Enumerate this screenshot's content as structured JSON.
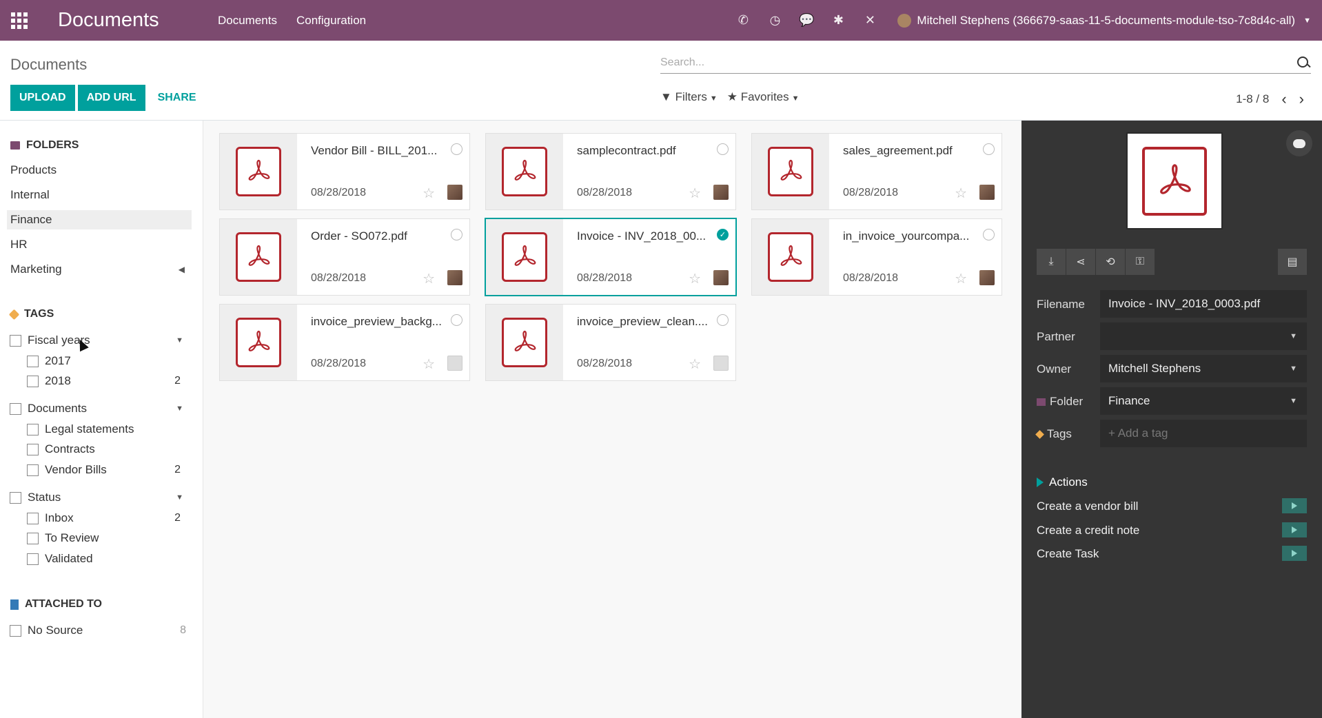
{
  "topbar": {
    "app_title": "Documents",
    "menu": [
      "Documents",
      "Configuration"
    ],
    "user_label": "Mitchell Stephens (366679-saas-11-5-documents-module-tso-7c8d4c-all)"
  },
  "control_panel": {
    "breadcrumb": "Documents",
    "buttons": {
      "upload": "UPLOAD",
      "add_url": "ADD URL",
      "share": "SHARE"
    },
    "search_placeholder": "Search...",
    "filters_label": "Filters",
    "favorites_label": "Favorites",
    "pager": "1-8 / 8"
  },
  "sidebar": {
    "folders_title": "FOLDERS",
    "folders": [
      "Products",
      "Internal",
      "Finance",
      "HR",
      "Marketing"
    ],
    "active_folder": "Finance",
    "tags_title": "TAGS",
    "tag_groups": [
      {
        "name": "Fiscal years",
        "items": [
          {
            "name": "2017",
            "count": ""
          },
          {
            "name": "2018",
            "count": "2"
          }
        ]
      },
      {
        "name": "Documents",
        "items": [
          {
            "name": "Legal statements",
            "count": ""
          },
          {
            "name": "Contracts",
            "count": ""
          },
          {
            "name": "Vendor Bills",
            "count": "2"
          }
        ]
      },
      {
        "name": "Status",
        "items": [
          {
            "name": "Inbox",
            "count": "2"
          },
          {
            "name": "To Review",
            "count": ""
          },
          {
            "name": "Validated",
            "count": ""
          }
        ]
      }
    ],
    "attached_title": "ATTACHED TO",
    "attached": [
      {
        "name": "No Source",
        "count": "8"
      }
    ]
  },
  "documents": [
    {
      "name": "Vendor Bill - BILL_201...",
      "date": "08/28/2018",
      "selected": false
    },
    {
      "name": "samplecontract.pdf",
      "date": "08/28/2018",
      "selected": false
    },
    {
      "name": "sales_agreement.pdf",
      "date": "08/28/2018",
      "selected": false
    },
    {
      "name": "Order - SO072.pdf",
      "date": "08/28/2018",
      "selected": false
    },
    {
      "name": "Invoice - INV_2018_00...",
      "date": "08/28/2018",
      "selected": true
    },
    {
      "name": "in_invoice_yourcompa...",
      "date": "08/28/2018",
      "selected": false
    },
    {
      "name": "invoice_preview_backg...",
      "date": "08/28/2018",
      "selected": false
    },
    {
      "name": "invoice_preview_clean....",
      "date": "08/28/2018",
      "selected": false
    }
  ],
  "panel": {
    "fields": {
      "filename_label": "Filename",
      "filename_value": "Invoice - INV_2018_0003.pdf",
      "partner_label": "Partner",
      "partner_value": "",
      "owner_label": "Owner",
      "owner_value": "Mitchell Stephens",
      "folder_label": "Folder",
      "folder_value": "Finance",
      "tags_label": "Tags",
      "tags_placeholder": "+ Add a tag"
    },
    "actions_title": "Actions",
    "actions": [
      "Create a vendor bill",
      "Create a credit note",
      "Create Task"
    ]
  },
  "colors": {
    "brand": "#7c4a6f",
    "accent": "#00a09d",
    "pdf_red": "#b3262d",
    "panel_bg": "#353535"
  }
}
